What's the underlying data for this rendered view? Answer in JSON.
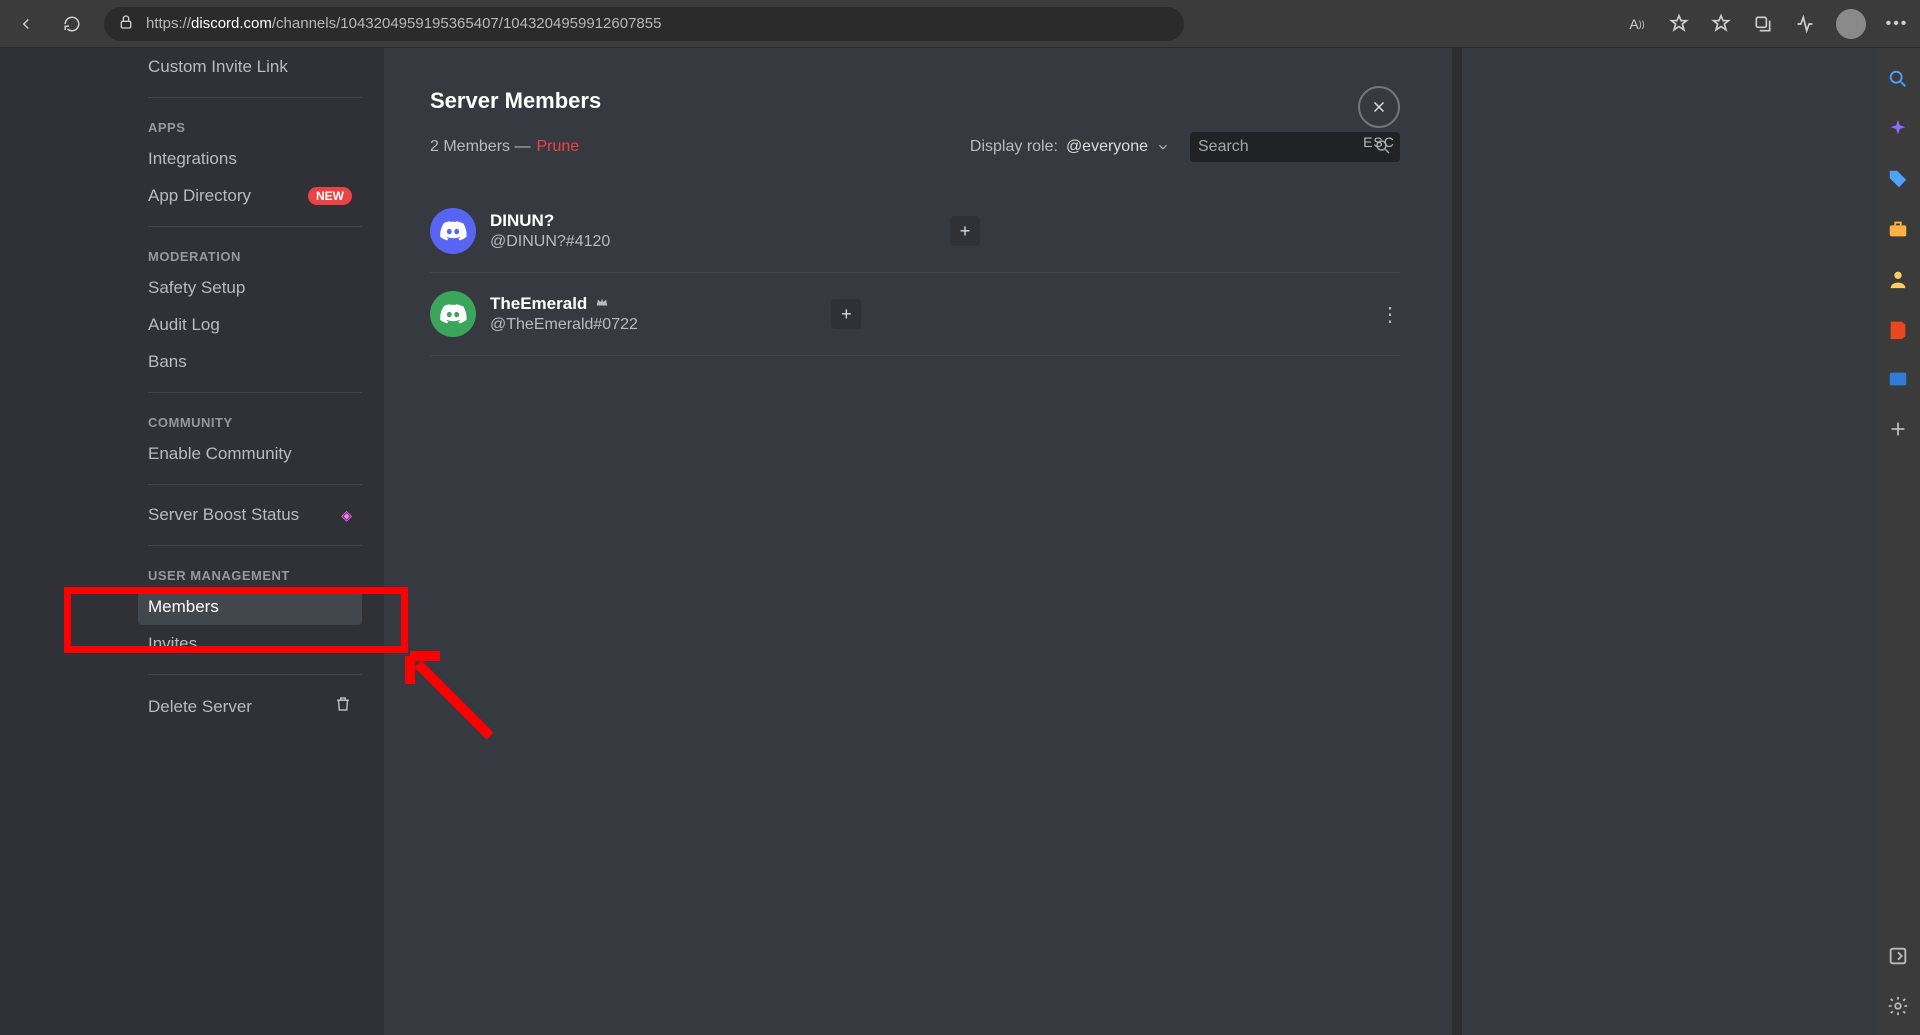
{
  "browser": {
    "url_prefix": "https://",
    "url_domain": "discord.com",
    "url_path": "/channels/1043204959195365407/1043204959912607855",
    "text_size_label": "A",
    "profile": ""
  },
  "sidebar": {
    "custom_invite": "Custom Invite Link",
    "apps_header": "APPS",
    "integrations": "Integrations",
    "app_directory": "App Directory",
    "new_badge": "NEW",
    "moderation_header": "MODERATION",
    "safety_setup": "Safety Setup",
    "audit_log": "Audit Log",
    "bans": "Bans",
    "community_header": "COMMUNITY",
    "enable_community": "Enable Community",
    "boost_status": "Server Boost Status",
    "user_mgmt_header": "USER MANAGEMENT",
    "members": "Members",
    "invites": "Invites",
    "delete_server": "Delete Server"
  },
  "main": {
    "title": "Server Members",
    "count_text": "2 Members —",
    "prune": "Prune",
    "display_role_label": "Display role:",
    "role_value": "@everyone",
    "search_placeholder": "Search",
    "esc": "ESC",
    "members": [
      {
        "name": "DINUN?",
        "tag": "@DINUN?#4120",
        "owner": false,
        "avatar_color": "blurple",
        "has_more": false
      },
      {
        "name": "TheEmerald",
        "tag": "@TheEmerald#0722",
        "owner": true,
        "avatar_color": "green",
        "has_more": true
      }
    ]
  }
}
